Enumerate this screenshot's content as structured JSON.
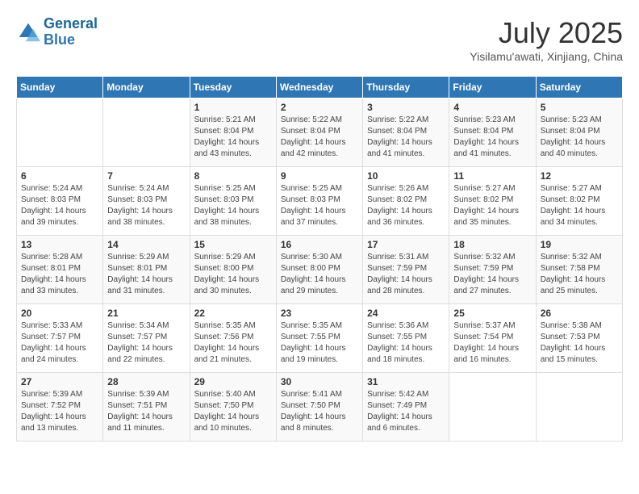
{
  "logo": {
    "line1": "General",
    "line2": "Blue"
  },
  "header": {
    "month": "July 2025",
    "location": "Yisilamu'awati, Xinjiang, China"
  },
  "days_of_week": [
    "Sunday",
    "Monday",
    "Tuesday",
    "Wednesday",
    "Thursday",
    "Friday",
    "Saturday"
  ],
  "weeks": [
    [
      {
        "day": "",
        "info": ""
      },
      {
        "day": "",
        "info": ""
      },
      {
        "day": "1",
        "info": "Sunrise: 5:21 AM\nSunset: 8:04 PM\nDaylight: 14 hours and 43 minutes."
      },
      {
        "day": "2",
        "info": "Sunrise: 5:22 AM\nSunset: 8:04 PM\nDaylight: 14 hours and 42 minutes."
      },
      {
        "day": "3",
        "info": "Sunrise: 5:22 AM\nSunset: 8:04 PM\nDaylight: 14 hours and 41 minutes."
      },
      {
        "day": "4",
        "info": "Sunrise: 5:23 AM\nSunset: 8:04 PM\nDaylight: 14 hours and 41 minutes."
      },
      {
        "day": "5",
        "info": "Sunrise: 5:23 AM\nSunset: 8:04 PM\nDaylight: 14 hours and 40 minutes."
      }
    ],
    [
      {
        "day": "6",
        "info": "Sunrise: 5:24 AM\nSunset: 8:03 PM\nDaylight: 14 hours and 39 minutes."
      },
      {
        "day": "7",
        "info": "Sunrise: 5:24 AM\nSunset: 8:03 PM\nDaylight: 14 hours and 38 minutes."
      },
      {
        "day": "8",
        "info": "Sunrise: 5:25 AM\nSunset: 8:03 PM\nDaylight: 14 hours and 38 minutes."
      },
      {
        "day": "9",
        "info": "Sunrise: 5:25 AM\nSunset: 8:03 PM\nDaylight: 14 hours and 37 minutes."
      },
      {
        "day": "10",
        "info": "Sunrise: 5:26 AM\nSunset: 8:02 PM\nDaylight: 14 hours and 36 minutes."
      },
      {
        "day": "11",
        "info": "Sunrise: 5:27 AM\nSunset: 8:02 PM\nDaylight: 14 hours and 35 minutes."
      },
      {
        "day": "12",
        "info": "Sunrise: 5:27 AM\nSunset: 8:02 PM\nDaylight: 14 hours and 34 minutes."
      }
    ],
    [
      {
        "day": "13",
        "info": "Sunrise: 5:28 AM\nSunset: 8:01 PM\nDaylight: 14 hours and 33 minutes."
      },
      {
        "day": "14",
        "info": "Sunrise: 5:29 AM\nSunset: 8:01 PM\nDaylight: 14 hours and 31 minutes."
      },
      {
        "day": "15",
        "info": "Sunrise: 5:29 AM\nSunset: 8:00 PM\nDaylight: 14 hours and 30 minutes."
      },
      {
        "day": "16",
        "info": "Sunrise: 5:30 AM\nSunset: 8:00 PM\nDaylight: 14 hours and 29 minutes."
      },
      {
        "day": "17",
        "info": "Sunrise: 5:31 AM\nSunset: 7:59 PM\nDaylight: 14 hours and 28 minutes."
      },
      {
        "day": "18",
        "info": "Sunrise: 5:32 AM\nSunset: 7:59 PM\nDaylight: 14 hours and 27 minutes."
      },
      {
        "day": "19",
        "info": "Sunrise: 5:32 AM\nSunset: 7:58 PM\nDaylight: 14 hours and 25 minutes."
      }
    ],
    [
      {
        "day": "20",
        "info": "Sunrise: 5:33 AM\nSunset: 7:57 PM\nDaylight: 14 hours and 24 minutes."
      },
      {
        "day": "21",
        "info": "Sunrise: 5:34 AM\nSunset: 7:57 PM\nDaylight: 14 hours and 22 minutes."
      },
      {
        "day": "22",
        "info": "Sunrise: 5:35 AM\nSunset: 7:56 PM\nDaylight: 14 hours and 21 minutes."
      },
      {
        "day": "23",
        "info": "Sunrise: 5:35 AM\nSunset: 7:55 PM\nDaylight: 14 hours and 19 minutes."
      },
      {
        "day": "24",
        "info": "Sunrise: 5:36 AM\nSunset: 7:55 PM\nDaylight: 14 hours and 18 minutes."
      },
      {
        "day": "25",
        "info": "Sunrise: 5:37 AM\nSunset: 7:54 PM\nDaylight: 14 hours and 16 minutes."
      },
      {
        "day": "26",
        "info": "Sunrise: 5:38 AM\nSunset: 7:53 PM\nDaylight: 14 hours and 15 minutes."
      }
    ],
    [
      {
        "day": "27",
        "info": "Sunrise: 5:39 AM\nSunset: 7:52 PM\nDaylight: 14 hours and 13 minutes."
      },
      {
        "day": "28",
        "info": "Sunrise: 5:39 AM\nSunset: 7:51 PM\nDaylight: 14 hours and 11 minutes."
      },
      {
        "day": "29",
        "info": "Sunrise: 5:40 AM\nSunset: 7:50 PM\nDaylight: 14 hours and 10 minutes."
      },
      {
        "day": "30",
        "info": "Sunrise: 5:41 AM\nSunset: 7:50 PM\nDaylight: 14 hours and 8 minutes."
      },
      {
        "day": "31",
        "info": "Sunrise: 5:42 AM\nSunset: 7:49 PM\nDaylight: 14 hours and 6 minutes."
      },
      {
        "day": "",
        "info": ""
      },
      {
        "day": "",
        "info": ""
      }
    ]
  ]
}
